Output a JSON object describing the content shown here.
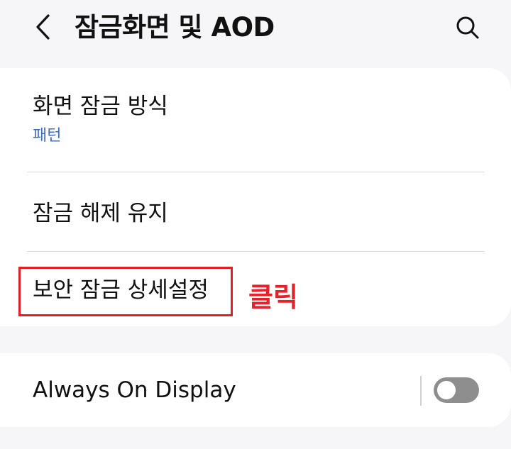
{
  "header": {
    "back_icon": "chevron-left-icon",
    "title": "잠금화면 및 AOD",
    "search_icon": "search-icon"
  },
  "lock_settings": {
    "items": [
      {
        "title": "화면 잠금 방식",
        "subtitle": "패턴"
      },
      {
        "title": "잠금 해제 유지"
      },
      {
        "title": "보안 잠금 상세설정"
      }
    ]
  },
  "annotation": {
    "text": "클릭",
    "color": "#e5222a"
  },
  "aod": {
    "title": "Always On Display",
    "toggle_state": "off"
  },
  "colors": {
    "background": "#f6f6f8",
    "card": "#ffffff",
    "subtitle_blue": "#3b6ec4",
    "highlight_red": "#e02020",
    "toggle_off": "#8e8e8e"
  }
}
